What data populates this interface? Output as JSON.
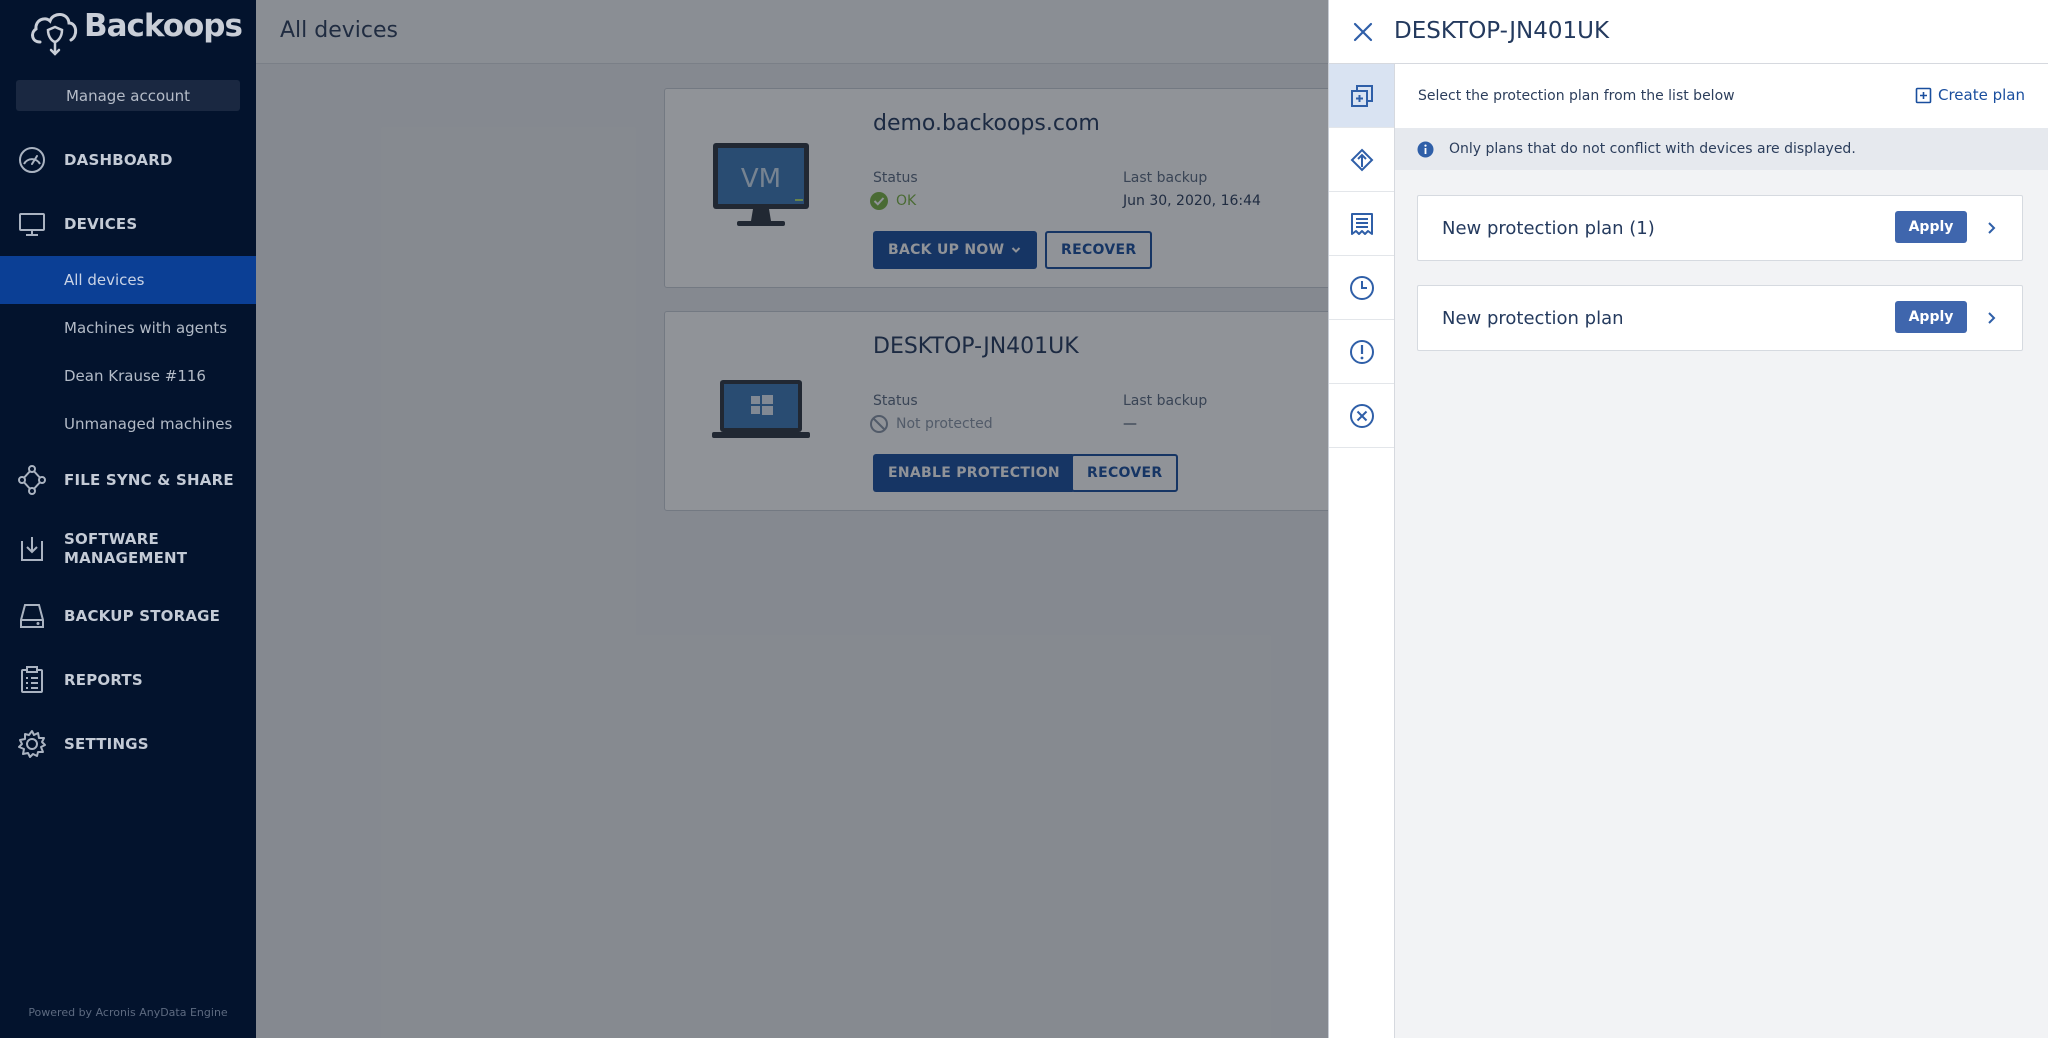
{
  "app": {
    "brand": "Backoops",
    "powered_by": "Powered by Acronis AnyData Engine"
  },
  "sidebar": {
    "manage_account": "Manage account",
    "nav": [
      {
        "label": "DASHBOARD",
        "icon": "gauge-icon"
      },
      {
        "label": "DEVICES",
        "icon": "monitor-icon"
      },
      {
        "label": "FILE SYNC & SHARE",
        "icon": "share-nodes-icon"
      },
      {
        "label": "SOFTWARE MANAGEMENT",
        "icon": "download-box-icon"
      },
      {
        "label": "BACKUP STORAGE",
        "icon": "drive-icon"
      },
      {
        "label": "REPORTS",
        "icon": "clipboard-icon"
      },
      {
        "label": "SETTINGS",
        "icon": "gear-icon"
      }
    ],
    "devices_sub": [
      {
        "label": "All devices",
        "active": true
      },
      {
        "label": "Machines with agents",
        "active": false
      },
      {
        "label": "Dean Krause #116",
        "active": false
      },
      {
        "label": "Unmanaged machines",
        "active": false
      }
    ]
  },
  "main": {
    "title": "All devices",
    "devices": [
      {
        "name": "demo.backoops.com",
        "image": "vm-monitor",
        "image_label": "VM",
        "status_label": "Status",
        "status": "OK",
        "last_backup_label": "Last backup",
        "last_backup": "Jun 30, 2020, 16:44",
        "primary_action": "BACK UP NOW",
        "secondary_action": "RECOVER"
      },
      {
        "name": "DESKTOP-JN401UK",
        "image": "windows-laptop",
        "status_label": "Status",
        "status": "Not protected",
        "last_backup_label": "Last backup",
        "last_backup": "—",
        "primary_action": "ENABLE PROTECTION",
        "secondary_action": "RECOVER"
      }
    ]
  },
  "panel": {
    "title": "DESKTOP-JN401UK",
    "tabs": [
      "protection-plans-icon",
      "upload-icon",
      "document-icon",
      "clock-icon",
      "alert-icon",
      "close-circle-icon"
    ],
    "instruction": "Select the protection plan from the list below",
    "create_plan": "Create plan",
    "info": "Only plans that do not conflict with devices are displayed.",
    "plans": [
      {
        "name": "New protection plan (1)",
        "action": "Apply"
      },
      {
        "name": "New protection plan",
        "action": "Apply"
      }
    ]
  },
  "colors": {
    "sidebar_bg": "#03132d",
    "active_item": "#0b3f95",
    "primary": "#194e9e",
    "apply": "#3f66ad",
    "ok_green": "#7cb342"
  }
}
